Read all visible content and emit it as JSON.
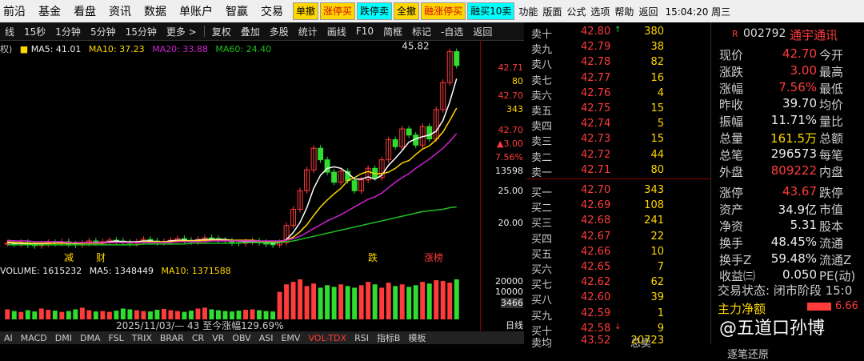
{
  "top_menu": {
    "items": [
      "前沿",
      "基金",
      "看盘",
      "资讯",
      "数据",
      "单账户",
      "智赢",
      "交易"
    ],
    "trade_buttons": [
      {
        "label": "单撤",
        "bg": "#ffd700",
        "fg": "#000"
      },
      {
        "label": "涨停买",
        "bg": "#ffd700",
        "fg": "#d00000"
      },
      {
        "label": "跌停卖",
        "bg": "#00ffff",
        "fg": "#000"
      },
      {
        "label": "全撤",
        "bg": "#ffd700",
        "fg": "#000"
      },
      {
        "label": "融涨停买",
        "bg": "#ffd700",
        "fg": "#d00000"
      },
      {
        "label": "融买10卖",
        "bg": "#00ffff",
        "fg": "#000"
      }
    ],
    "func_items": [
      "功能",
      "版面",
      "公式",
      "选项",
      "帮助",
      "返回"
    ],
    "clock": "15:04:20 周三"
  },
  "toolbar": {
    "left_items": [
      "线",
      "15秒",
      "1分钟",
      "5分钟",
      "15分钟",
      "更多 >"
    ],
    "right_items": [
      "复权",
      "叠加",
      "多股",
      "统计",
      "画线",
      "F10",
      "简框",
      "标记",
      "-自选",
      "返回"
    ]
  },
  "ma_legend": {
    "prefix": "权)",
    "ma5": "MA5: 41.01",
    "ma10": "MA10: 37.23",
    "ma20": "MA20: 33.88",
    "ma60": "MA60: 24.40"
  },
  "chart_data": {
    "type": "line",
    "title": "",
    "xlabel": "",
    "ylabel": "",
    "ylim": [
      17,
      46
    ],
    "close": [
      19.7,
      19.6,
      19.8,
      19.5,
      19.4,
      19.6,
      19.8,
      19.7,
      19.9,
      19.6,
      19.5,
      19.7,
      20.0,
      19.8,
      19.9,
      20.1,
      20.0,
      19.8,
      19.7,
      19.9,
      20.2,
      20.0,
      19.8,
      19.9,
      20.1,
      20.3,
      20.1,
      19.9,
      20.2,
      20.4,
      20.3,
      20.1,
      20.0,
      19.8,
      19.7,
      19.9,
      20.0,
      19.8,
      19.6,
      19.5,
      19.8,
      22.0,
      24.1,
      26.5,
      29.2,
      32.0,
      30.5,
      28.9,
      27.6,
      29.0,
      27.8,
      26.5,
      27.9,
      29.4,
      28.2,
      30.5,
      33.1,
      32.2,
      34.5,
      33.7,
      32.4,
      34.8,
      33.2,
      37.0,
      40.5,
      44.5,
      42.7
    ],
    "ma5": [
      19.8,
      19.7,
      19.7,
      19.6,
      19.6,
      19.6,
      19.7,
      19.7,
      19.8,
      19.7,
      19.7,
      19.7,
      19.8,
      19.8,
      19.8,
      19.9,
      20.0,
      19.9,
      19.9,
      19.9,
      20.0,
      20.0,
      19.9,
      19.9,
      20.0,
      20.1,
      20.1,
      20.0,
      20.1,
      20.2,
      20.2,
      20.2,
      20.2,
      20.1,
      20.0,
      19.9,
      19.9,
      19.8,
      19.8,
      19.7,
      19.8,
      20.2,
      21.1,
      22.4,
      24.3,
      26.8,
      28.5,
      29.4,
      29.6,
      29.4,
      28.8,
      28.0,
      28.0,
      28.3,
      28.0,
      28.5,
      29.8,
      30.7,
      31.7,
      32.8,
      33.2,
      33.5,
      33.7,
      34.2,
      35.6,
      38.0,
      41.0
    ],
    "ma10": [
      19.9,
      19.8,
      19.8,
      19.7,
      19.7,
      19.7,
      19.7,
      19.7,
      19.7,
      19.7,
      19.7,
      19.7,
      19.7,
      19.7,
      19.7,
      19.8,
      19.8,
      19.8,
      19.8,
      19.8,
      19.9,
      19.9,
      19.9,
      19.9,
      19.9,
      20.0,
      20.0,
      20.0,
      20.0,
      20.1,
      20.1,
      20.1,
      20.1,
      20.1,
      20.1,
      20.1,
      20.1,
      20.0,
      19.9,
      19.9,
      19.9,
      20.1,
      20.5,
      21.2,
      22.1,
      23.3,
      24.4,
      25.3,
      26.1,
      26.8,
      27.8,
      28.2,
      28.7,
      29.0,
      28.7,
      28.7,
      28.9,
      29.4,
      30.1,
      30.4,
      31.2,
      31.9,
      32.3,
      33.1,
      34.1,
      35.6,
      37.2
    ],
    "ma20": [
      20.1,
      20.0,
      20.0,
      20.0,
      19.9,
      19.9,
      19.9,
      19.9,
      19.9,
      19.8,
      19.8,
      19.8,
      19.8,
      19.8,
      19.8,
      19.8,
      19.8,
      19.8,
      19.8,
      19.8,
      19.8,
      19.8,
      19.8,
      19.8,
      19.8,
      19.9,
      19.9,
      19.9,
      19.9,
      19.9,
      20.0,
      20.0,
      20.0,
      20.0,
      20.0,
      20.0,
      20.0,
      20.0,
      20.0,
      20.0,
      20.0,
      20.1,
      20.3,
      20.6,
      21.1,
      21.6,
      22.1,
      22.6,
      23.0,
      23.4,
      23.9,
      24.4,
      24.9,
      25.4,
      25.7,
      26.2,
      26.9,
      27.6,
      28.2,
      28.7,
      29.4,
      30.0,
      30.6,
      31.3,
      32.0,
      32.9,
      33.9
    ],
    "ma60": [
      19.5,
      19.5,
      19.5,
      19.5,
      19.5,
      19.5,
      19.5,
      19.5,
      19.5,
      19.5,
      19.5,
      19.5,
      19.5,
      19.5,
      19.5,
      19.5,
      19.5,
      19.5,
      19.5,
      19.5,
      19.6,
      19.6,
      19.6,
      19.6,
      19.6,
      19.6,
      19.6,
      19.7,
      19.7,
      19.7,
      19.7,
      19.7,
      19.7,
      19.7,
      19.7,
      19.8,
      19.8,
      19.8,
      19.8,
      19.8,
      19.8,
      19.9,
      20.0,
      20.2,
      20.4,
      20.6,
      20.8,
      21.0,
      21.2,
      21.4,
      21.6,
      21.8,
      22.0,
      22.2,
      22.4,
      22.6,
      22.8,
      23.0,
      23.2,
      23.4,
      23.6,
      23.8,
      23.9,
      24.0,
      24.1,
      24.3,
      24.4
    ],
    "peak_label": "45.82",
    "y_ticks": [
      20.0,
      25.0
    ],
    "right_axis_labels": [
      "42.71",
      "80",
      "42.70",
      "343",
      "42.70",
      "▲3.00",
      "7.56%",
      "13598"
    ],
    "markers": [
      "减",
      "财",
      "跌",
      "涨榜"
    ]
  },
  "volume": {
    "label": "VOLUME: 1615232",
    "ma5": "MA5: 1348449",
    "ma10": "MA10: 1371588",
    "bars": [
      120,
      100,
      90,
      110,
      95,
      130,
      115,
      105,
      90,
      100,
      120,
      140,
      110,
      95,
      100,
      90,
      105,
      130,
      120,
      110,
      100,
      95,
      115,
      125,
      110,
      100,
      90,
      105,
      130,
      140,
      120,
      110,
      100,
      95,
      105,
      115,
      120,
      110,
      100,
      95,
      330,
      420,
      450,
      480,
      400,
      430,
      380,
      410,
      390,
      420,
      400,
      380,
      410,
      450,
      420,
      380,
      440,
      400,
      420,
      390,
      410,
      450,
      430,
      470,
      460,
      440,
      480
    ],
    "y_ticks": [
      "20000",
      "10000"
    ],
    "current": "3466"
  },
  "range_text": "2025/11/03/— 43 至今涨幅129.69%",
  "indicator_tabs": [
    "AI",
    "MACD",
    "DMI",
    "DMA",
    "FSL",
    "TRIX",
    "BRAR",
    "CR",
    "VR",
    "OBV",
    "ASI",
    "EMV",
    "VOL-TDX",
    "RSI",
    "指标B",
    "模板"
  ],
  "axis_bottom": "日线",
  "orderbook": {
    "asks": [
      {
        "label": "卖十",
        "price": "42.80",
        "vol": "380",
        "flag": "↑"
      },
      {
        "label": "卖九",
        "price": "42.79",
        "vol": "38"
      },
      {
        "label": "卖八",
        "price": "42.78",
        "vol": "82"
      },
      {
        "label": "卖七",
        "price": "42.77",
        "vol": "16"
      },
      {
        "label": "卖六",
        "price": "42.76",
        "vol": "4"
      },
      {
        "label": "卖五",
        "price": "42.75",
        "vol": "15"
      },
      {
        "label": "卖四",
        "price": "42.74",
        "vol": "5"
      },
      {
        "label": "卖三",
        "price": "42.73",
        "vol": "15"
      },
      {
        "label": "卖二",
        "price": "42.72",
        "vol": "44"
      },
      {
        "label": "卖一",
        "price": "42.71",
        "vol": "80"
      }
    ],
    "bids": [
      {
        "label": "买一",
        "price": "42.70",
        "vol": "343"
      },
      {
        "label": "买二",
        "price": "42.69",
        "vol": "108"
      },
      {
        "label": "买三",
        "price": "42.68",
        "vol": "241"
      },
      {
        "label": "买四",
        "price": "42.67",
        "vol": "22"
      },
      {
        "label": "买五",
        "price": "42.66",
        "vol": "10"
      },
      {
        "label": "买六",
        "price": "42.65",
        "vol": "7"
      },
      {
        "label": "买七",
        "price": "42.62",
        "vol": "62"
      },
      {
        "label": "买八",
        "price": "42.60",
        "vol": "39"
      },
      {
        "label": "买九",
        "price": "42.59",
        "vol": "1"
      },
      {
        "label": "买十",
        "price": "42.58",
        "vol": "9",
        "flag": "↓"
      }
    ],
    "bottom_row": {
      "label": "卖均",
      "price": "43.52",
      "total_label": "总卖",
      "total": "20723"
    }
  },
  "quote": {
    "badge": "R",
    "code": "002792",
    "name": "通宇通讯",
    "rows": [
      {
        "k": "现价",
        "v": "42.70",
        "c": "red",
        "k2": "今开"
      },
      {
        "k": "涨跌",
        "v": "3.00",
        "c": "red",
        "k2": "最高"
      },
      {
        "k": "涨幅",
        "v": "7.56%",
        "c": "red",
        "k2": "最低"
      },
      {
        "k": "昨收",
        "v": "39.70",
        "c": "white",
        "k2": "均价"
      },
      {
        "k": "振幅",
        "v": "11.71%",
        "c": "white",
        "k2": "量比"
      },
      {
        "k": "总量",
        "v": "161.5万",
        "c": "yellow",
        "k2": "总额"
      },
      {
        "k": "总笔",
        "v": "296573",
        "c": "white",
        "k2": "每笔"
      },
      {
        "k": "外盘",
        "v": "809222",
        "c": "red",
        "k2": "内盘"
      },
      {
        "k": "涨停",
        "v": "43.67",
        "c": "red",
        "k2": "跌停"
      },
      {
        "k": "资产",
        "v": "34.9亿",
        "c": "white",
        "k2": "市值"
      },
      {
        "k": "净资",
        "v": "5.31",
        "c": "white",
        "k2": "股本"
      },
      {
        "k": "换手",
        "v": "48.45%",
        "c": "white",
        "k2": "流通"
      },
      {
        "k": "换手Z",
        "v": "59.48%",
        "c": "white",
        "k2": "流通Z"
      },
      {
        "k": "收益㈢",
        "v": "0.050",
        "c": "white",
        "k2": "PE(动)"
      }
    ],
    "status": "交易状态: 闭市阶段 15:0",
    "net_inflow": "主力净额",
    "net_value": "6.66",
    "watermark": "@五道口孙博",
    "footer": "逐笔还原"
  },
  "colors": {
    "up": "#ff3b3b",
    "down": "#2fdc2f",
    "ma5": "#ffffff",
    "ma10": "#ffd700",
    "ma20": "#d020d0",
    "ma60": "#1fbf1f"
  }
}
